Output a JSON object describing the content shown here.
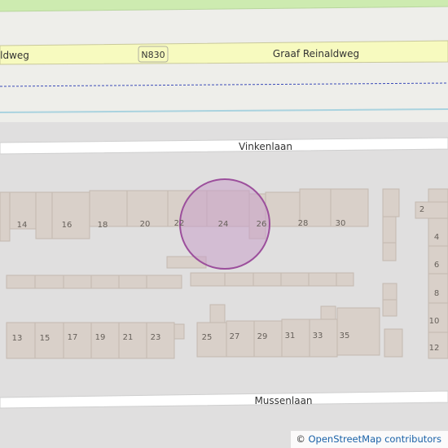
{
  "map": {
    "streets": {
      "main": "Graaf Reinaldweg",
      "main_left": "ldweg",
      "road_ref": "N830",
      "north": "Vinkenlaan",
      "south": "Mussenlaan"
    },
    "house_numbers": {
      "row1": [
        "14",
        "16",
        "18",
        "20",
        "22",
        "24",
        "26",
        "28",
        "30"
      ],
      "row2": [
        "13",
        "15",
        "17",
        "19",
        "21",
        "23",
        "25",
        "27",
        "29",
        "31",
        "33",
        "35"
      ],
      "east": [
        "2",
        "4",
        "6",
        "8",
        "10",
        "12"
      ]
    },
    "marker": {
      "fill": "#c8a0c8",
      "stroke": "#9c4f9c"
    },
    "colors": {
      "main_road": "#f7fabf",
      "residential": "#e0dfdf",
      "building": "#d9d0c9",
      "park": "#cdebb0",
      "water": "#aad3df"
    }
  },
  "attribution": {
    "symbol": "©",
    "link": "OpenStreetMap contributors"
  }
}
